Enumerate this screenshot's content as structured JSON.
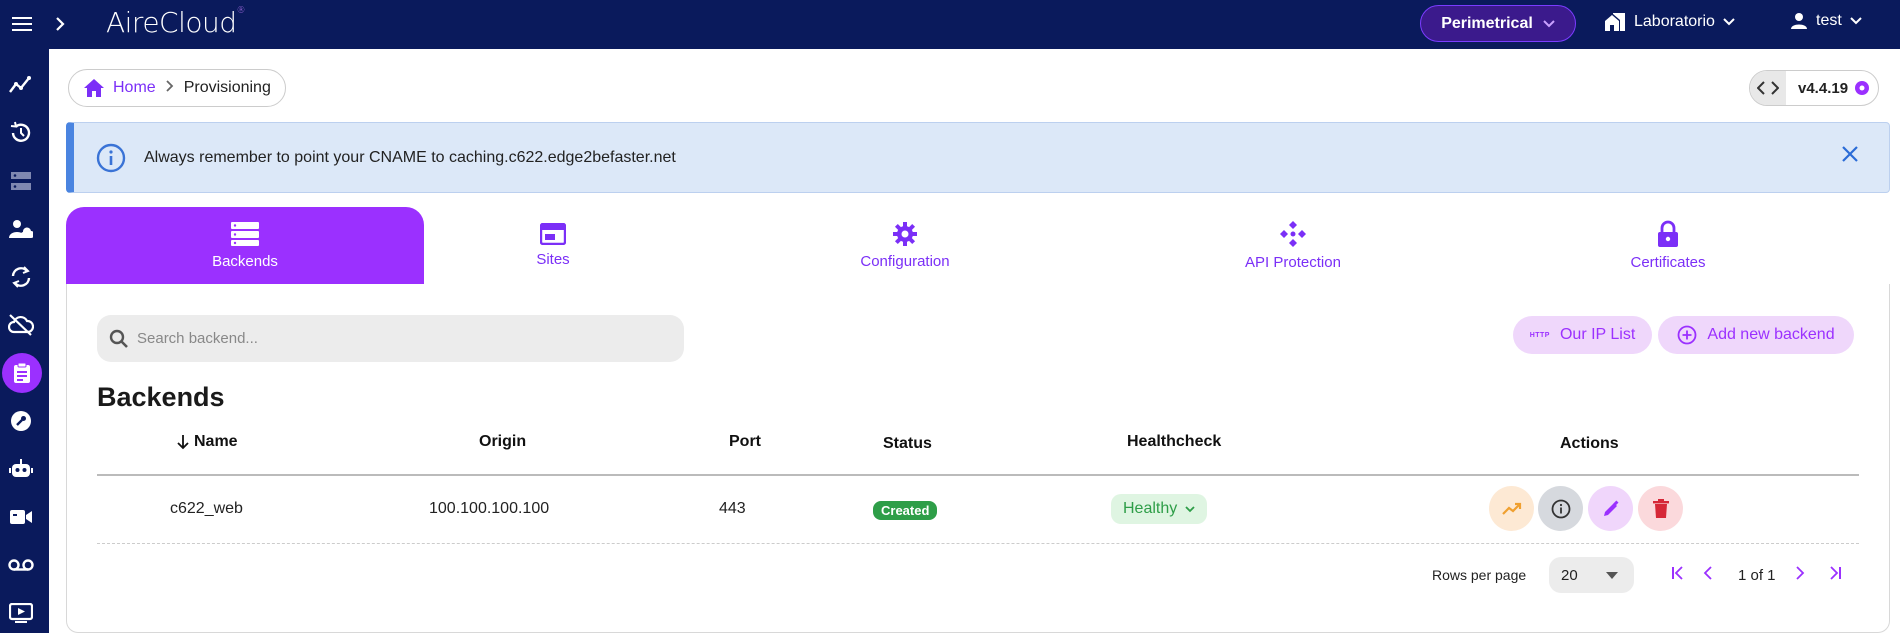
{
  "app": {
    "logo": "AireCloud",
    "logo_mark": "®"
  },
  "header": {
    "tenant": "Perimetrical",
    "site": "Laboratorio",
    "user": "test"
  },
  "sidebar": {
    "items": [
      {
        "icon": "analytics-icon"
      },
      {
        "icon": "history-icon"
      },
      {
        "icon": "servers-icon"
      },
      {
        "icon": "users-cloud-icon"
      },
      {
        "icon": "sync-icon"
      },
      {
        "icon": "cloud-off-icon"
      },
      {
        "icon": "clipboard-icon",
        "active": true
      },
      {
        "icon": "wrench-icon"
      },
      {
        "icon": "robot-icon"
      },
      {
        "icon": "video-icon"
      },
      {
        "icon": "voicemail-icon"
      },
      {
        "icon": "play-screen-icon"
      }
    ]
  },
  "breadcrumb": {
    "home": "Home",
    "current": "Provisioning"
  },
  "version": "v4.4.19",
  "banner": {
    "text": "Always remember to point your CNAME to caching.c622.edge2befaster.net"
  },
  "tabs": [
    {
      "label": "Backends",
      "icon": "servers-icon",
      "active": true
    },
    {
      "label": "Sites",
      "icon": "browser-window-icon"
    },
    {
      "label": "Configuration",
      "icon": "gear-icon"
    },
    {
      "label": "API Protection",
      "icon": "api-nodes-icon"
    },
    {
      "label": "Certificates",
      "icon": "lock-icon"
    }
  ],
  "search": {
    "placeholder": "Search backend..."
  },
  "buttons": {
    "ip_list": "Our IP List",
    "ip_list_icon_text": "HTTP",
    "add_backend": "Add new backend"
  },
  "section_title": "Backends",
  "table": {
    "columns": [
      "Name",
      "Origin",
      "Port",
      "Status",
      "Healthcheck",
      "Actions"
    ],
    "rows": [
      {
        "name": "c622_web",
        "origin": "100.100.100.100",
        "port": "443",
        "status": "Created",
        "healthcheck": "Healthy"
      }
    ]
  },
  "pagination": {
    "rows_label": "Rows per page",
    "rows_value": "20",
    "info": "1 of 1"
  },
  "colors": {
    "topbar": "#0a1a5c",
    "accent": "#9b30ff",
    "banner_bg": "#dce8f8"
  }
}
